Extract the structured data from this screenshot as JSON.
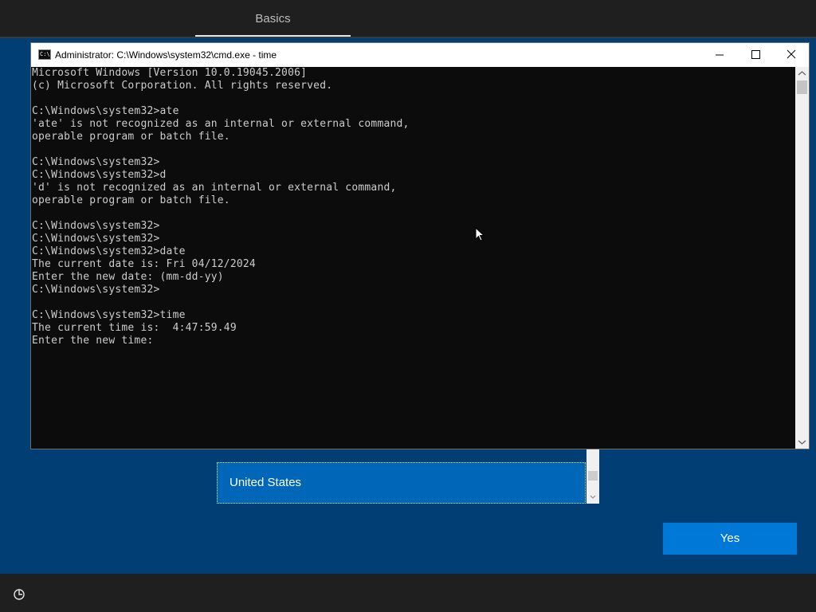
{
  "oobe": {
    "tab_label": "Basics",
    "region_selected": "United States",
    "yes_label": "Yes"
  },
  "cmd": {
    "title": "Administrator: C:\\Windows\\system32\\cmd.exe - time",
    "output": "Microsoft Windows [Version 10.0.19045.2006]\n(c) Microsoft Corporation. All rights reserved.\n\nC:\\Windows\\system32>ate\n'ate' is not recognized as an internal or external command,\noperable program or batch file.\n\nC:\\Windows\\system32>\nC:\\Windows\\system32>d\n'd' is not recognized as an internal or external command,\noperable program or batch file.\n\nC:\\Windows\\system32>\nC:\\Windows\\system32>\nC:\\Windows\\system32>date\nThe current date is: Fri 04/12/2024\nEnter the new date: (mm-dd-yy)\nC:\\Windows\\system32>\n\nC:\\Windows\\system32>time\nThe current time is:  4:47:59.49\nEnter the new time:"
  },
  "icons": {
    "minimize": "minimize-icon",
    "maximize": "maximize-icon",
    "close": "close-icon",
    "accessibility": "accessibility-icon"
  }
}
